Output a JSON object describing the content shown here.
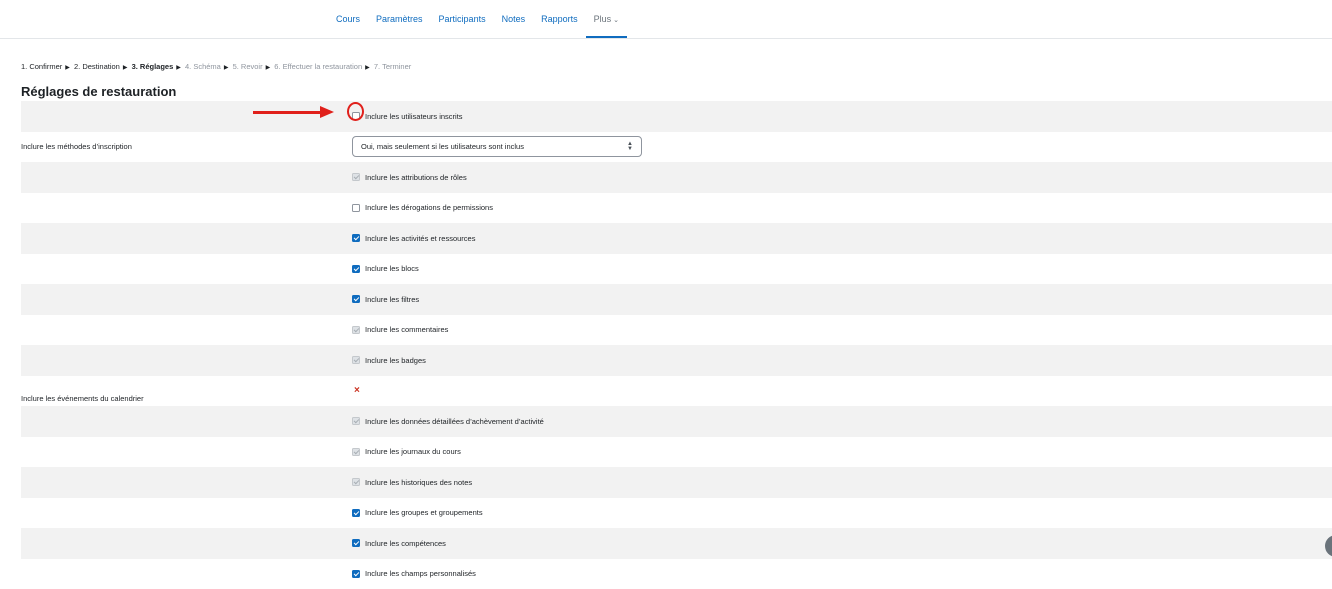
{
  "nav": {
    "tabs": [
      "Cours",
      "Paramètres",
      "Participants",
      "Notes",
      "Rapports"
    ],
    "more_label": "Plus"
  },
  "steps": [
    {
      "label": "1. Confirmer",
      "state": "done"
    },
    {
      "label": "2. Destination",
      "state": "done"
    },
    {
      "label": "3. Réglages",
      "state": "current"
    },
    {
      "label": "4. Schéma",
      "state": "future"
    },
    {
      "label": "5. Revoir",
      "state": "future"
    },
    {
      "label": "6. Effectuer la restauration",
      "state": "future"
    },
    {
      "label": "7. Terminer",
      "state": "future"
    }
  ],
  "heading": "Réglages de restauration",
  "settings": {
    "users": {
      "label": "",
      "checkbox_label": "Inclure les utilisateurs inscrits",
      "state": "unchecked"
    },
    "enrolment": {
      "label": "Inclure les méthodes d’inscription",
      "select_value": "Oui, mais seulement si les utilisateurs sont inclus"
    },
    "role_assignments": {
      "checkbox_label": "Inclure les attributions de rôles",
      "state": "disabled"
    },
    "permissions": {
      "checkbox_label": "Inclure les dérogations de permissions",
      "state": "unchecked"
    },
    "activities": {
      "checkbox_label": "Inclure les activités et ressources",
      "state": "checked"
    },
    "blocks": {
      "checkbox_label": "Inclure les blocs",
      "state": "checked"
    },
    "filters": {
      "checkbox_label": "Inclure les filtres",
      "state": "checked"
    },
    "comments": {
      "checkbox_label": "Inclure les commentaires",
      "state": "disabled"
    },
    "badges": {
      "checkbox_label": "Inclure les badges",
      "state": "disabled"
    },
    "calendar": {
      "label": "Inclure les événements du calendrier",
      "value_mark": "×"
    },
    "completion": {
      "checkbox_label": "Inclure les données détaillées d’achèvement d’activité",
      "state": "disabled"
    },
    "logs": {
      "checkbox_label": "Inclure les journaux du cours",
      "state": "disabled"
    },
    "grade_histories": {
      "checkbox_label": "Inclure les historiques des notes",
      "state": "disabled"
    },
    "groups": {
      "checkbox_label": "Inclure les groupes et groupements",
      "state": "checked"
    },
    "competencies": {
      "checkbox_label": "Inclure les compétences",
      "state": "checked"
    },
    "custom_fields": {
      "checkbox_label": "Inclure les champs personnalisés",
      "state": "checked"
    }
  },
  "colors": {
    "link": "#0f6cbf",
    "annotation": "#e0201b",
    "error_mark": "#ca3120"
  }
}
